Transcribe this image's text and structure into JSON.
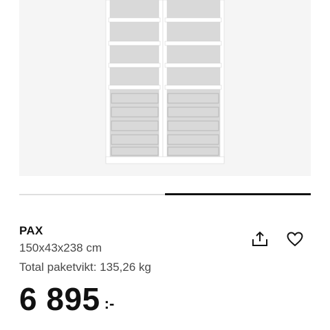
{
  "product": {
    "name": "PAX",
    "dimensions": "150x43x238 cm",
    "weight": "Total paketvikt: 135,26 kg",
    "price_number": "6 895",
    "price_suffix": ":-",
    "image_description_icon": "wardrobe-image"
  },
  "carousel": {
    "progress": 0.5
  },
  "actions": {
    "share_icon": "share-icon",
    "favorite_icon": "heart-icon"
  },
  "colors": {
    "text": "#111111",
    "secondary_text": "#484848",
    "image_bg": "#f5f5f5",
    "track": "#dfdfdf"
  }
}
